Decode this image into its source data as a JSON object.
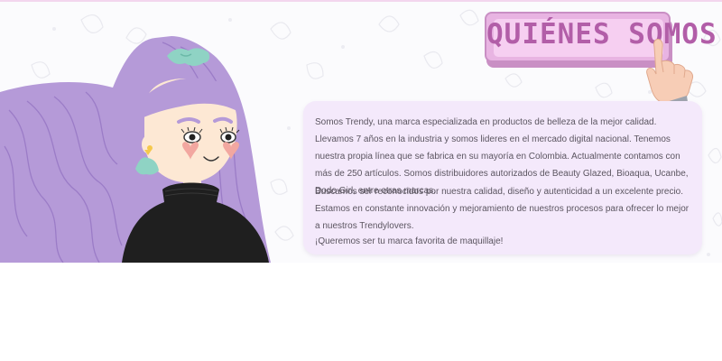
{
  "about": {
    "title": "QUIÉNES SOMOS",
    "paragraphs": [
      "Somos Trendy, una marca especializada en productos de belleza de la mejor calidad. Llevamos 7 años en la industria y somos lideres en el mercado digital nacional. Tenemos nuestra propia línea que se fabrica en su mayoría en Colombia. Actualmente contamos con más de 250 artículos. Somos distribuidores autorizados de Beauty Glazed, Bioaqua, Ucanbe, Dodo Girl, entre otras marcas.",
      "Buscamos ser reconocidos por nuestra calidad, diseño y autenticidad a un excelente precio. Estamos en constante innovación y mejoramiento de nuestros procesos para ofrecer lo mejor a nuestros Trendylovers.",
      "¡Queremos ser tu marca favorita de maquillaje!"
    ]
  },
  "icons": {
    "illustration": "girl-illustration-icon",
    "hand": "pointing-hand-icon",
    "pattern": "leaf-pattern-icon"
  },
  "colors": {
    "hair": "#b59ad8",
    "title_text": "#b25ea8",
    "title_face": "#e8b4e2",
    "card_bg": "#f4e9fb",
    "sweater": "#1f1f1f"
  }
}
